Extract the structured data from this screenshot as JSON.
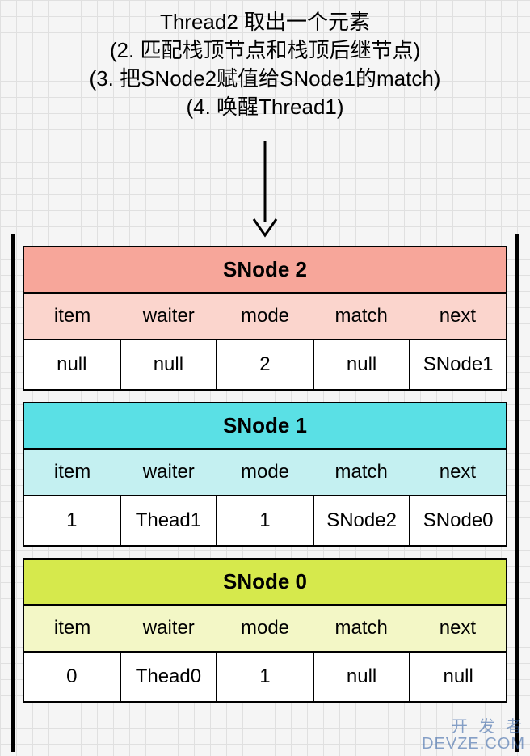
{
  "caption": {
    "line1": "Thread2 取出一个元素",
    "line2": "(2. 匹配栈顶节点和栈顶后继节点)",
    "line3": "(3. 把SNode2赋值给SNode1的match)",
    "line4": "(4. 唤醒Thread1)"
  },
  "columns": [
    "item",
    "waiter",
    "mode",
    "match",
    "next"
  ],
  "nodes": [
    {
      "title": "SNode 2",
      "item": "null",
      "waiter": "null",
      "mode": "2",
      "match": "null",
      "next": "SNode1",
      "class": "n2"
    },
    {
      "title": "SNode 1",
      "item": "1",
      "waiter": "Thead1",
      "mode": "1",
      "match": "SNode2",
      "next": "SNode0",
      "class": "n1"
    },
    {
      "title": "SNode 0",
      "item": "0",
      "waiter": "Thead0",
      "mode": "1",
      "match": "null",
      "next": "null",
      "class": "n0"
    }
  ],
  "watermark": {
    "line1": "开 发 者",
    "line2": "DEVZE.COM"
  }
}
